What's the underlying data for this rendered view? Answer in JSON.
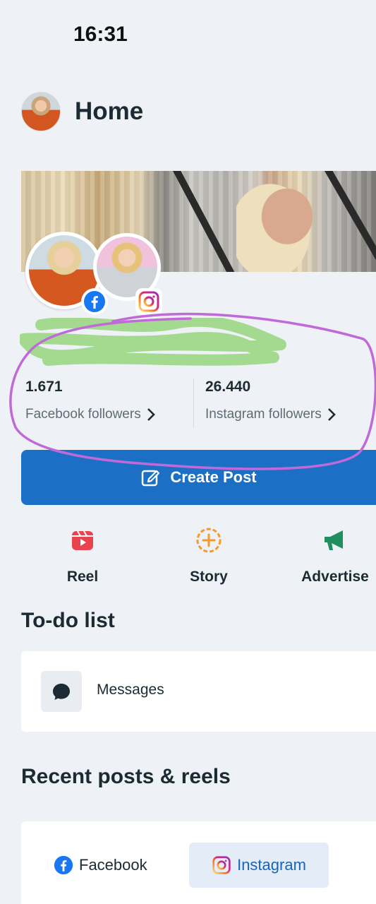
{
  "status": {
    "time": "16:31"
  },
  "header": {
    "title": "Home"
  },
  "stats": {
    "facebook": {
      "value": "1.671",
      "label": "Facebook followers"
    },
    "instagram": {
      "value": "26.440",
      "label": "Instagram followers"
    }
  },
  "create_post": {
    "label": "Create Post"
  },
  "actions": [
    {
      "label": "Reel",
      "icon": "reel-icon",
      "color": "#e8434f"
    },
    {
      "label": "Story",
      "icon": "story-add-icon",
      "color": "#f39a2b"
    },
    {
      "label": "Advertise",
      "icon": "megaphone-icon",
      "color": "#1f8f5f"
    }
  ],
  "todo": {
    "title": "To-do list",
    "items": [
      {
        "label": "Messages",
        "icon": "chat-bubble-icon"
      }
    ]
  },
  "recent": {
    "title": "Recent posts & reels",
    "tabs": [
      {
        "label": "Facebook",
        "selected": false
      },
      {
        "label": "Instagram",
        "selected": true
      }
    ]
  },
  "colors": {
    "primary_button": "#1b6fc4",
    "facebook_blue": "#1877f2",
    "annotation_purple": "#c06ad9",
    "scribble_green": "#9fd88a"
  }
}
